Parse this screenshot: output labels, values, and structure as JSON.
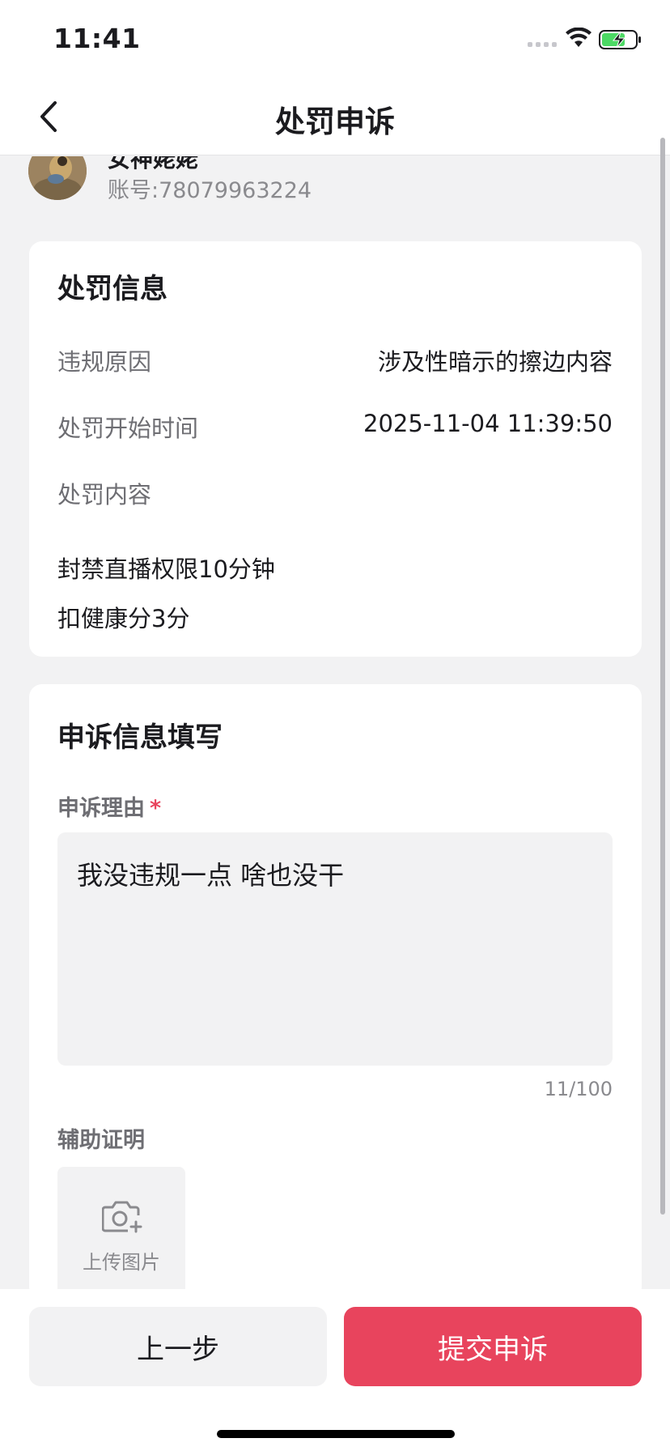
{
  "status_bar": {
    "time": "11:41"
  },
  "nav": {
    "title": "处罚申诉"
  },
  "user": {
    "name": "女神姥姥",
    "account": "账号:78079963224"
  },
  "penalty_info": {
    "title": "处罚信息",
    "rows": [
      {
        "label": "违规原因",
        "value": "涉及性暗示的擦边内容"
      },
      {
        "label": "处罚开始时间",
        "value": "2025-11-04 11:39:50"
      },
      {
        "label": "处罚内容",
        "value": ""
      }
    ],
    "contents": [
      "封禁直播权限10分钟",
      "扣健康分3分"
    ]
  },
  "appeal": {
    "title": "申诉信息填写",
    "reason_label": "申诉理由",
    "required_mark": "*",
    "reason_text": "我没违规一点 啥也没干",
    "char_count": "11/100",
    "evidence_label": "辅助证明",
    "upload_label": "上传图片"
  },
  "buttons": {
    "prev": "上一步",
    "submit": "提交申诉"
  },
  "colors": {
    "accent": "#e8445d",
    "background": "#f2f2f3",
    "battery_green": "#4cd964"
  }
}
